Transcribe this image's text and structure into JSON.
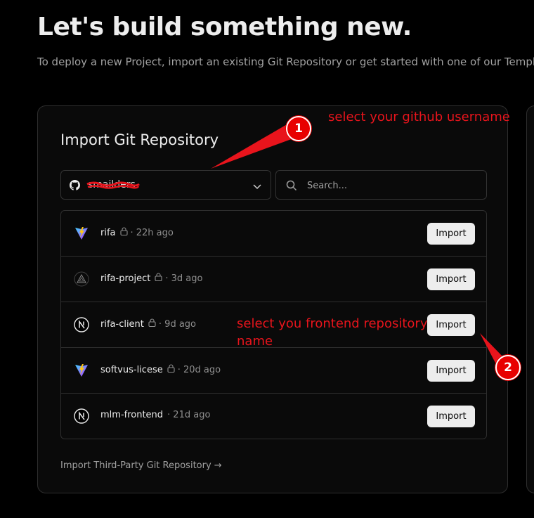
{
  "header": {
    "title": "Let's build something new.",
    "subtitle": "To deploy a new Project, import an existing Git Repository or get started with one of our Templat"
  },
  "import_card": {
    "title": "Import Git Repository",
    "scope_select": {
      "selected": "smailders",
      "icon": "github-icon"
    },
    "search": {
      "placeholder": "Search..."
    },
    "repositories": [
      {
        "name": "rifa",
        "time": "· 22h ago",
        "icon": "vite-icon",
        "private": true,
        "button": "Import"
      },
      {
        "name": "rifa-project",
        "time": "· 3d ago",
        "icon": "triangle-icon",
        "private": true,
        "button": "Import"
      },
      {
        "name": "rifa-client",
        "time": "· 9d ago",
        "icon": "nextjs-icon",
        "private": true,
        "button": "Import"
      },
      {
        "name": "softvus-licese",
        "time": "· 20d ago",
        "icon": "vite-icon",
        "private": true,
        "button": "Import"
      },
      {
        "name": "mlm-frontend",
        "time": "· 21d ago",
        "icon": "nextjs-icon",
        "private": false,
        "button": "Import"
      }
    ],
    "third_party_link": "Import Third-Party Git Repository →"
  },
  "annotations": {
    "color": "#e8141c",
    "note1": {
      "number": "1",
      "text": "select your github username"
    },
    "note2": {
      "number": "2",
      "text_line1": "select you frontend repository",
      "text_line2": "name"
    }
  }
}
